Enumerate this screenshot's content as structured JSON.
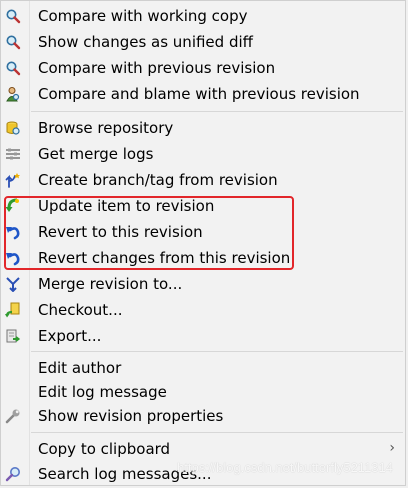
{
  "menu": {
    "items": [
      {
        "label": "Compare with working copy",
        "icon": "magnifier-icon"
      },
      {
        "label": "Show changes as unified diff",
        "icon": "magnifier-icon"
      },
      {
        "label": "Compare with previous revision",
        "icon": "magnifier-icon"
      },
      {
        "label": "Compare and blame with previous revision",
        "icon": "blame-icon"
      },
      {
        "label": "Browse repository",
        "icon": "repository-icon"
      },
      {
        "label": "Get merge logs",
        "icon": "merge-logs-icon"
      },
      {
        "label": "Create branch/tag from revision",
        "icon": "branch-icon"
      },
      {
        "label": "Update item to revision",
        "icon": "update-icon"
      },
      {
        "label": "Revert to this revision",
        "icon": "revert-icon"
      },
      {
        "label": "Revert changes from this revision",
        "icon": "revert-icon"
      },
      {
        "label": "Merge revision to...",
        "icon": "merge-icon"
      },
      {
        "label": "Checkout...",
        "icon": "checkout-icon"
      },
      {
        "label": "Export...",
        "icon": "export-icon"
      },
      {
        "label": "Edit author",
        "icon": ""
      },
      {
        "label": "Edit log message",
        "icon": ""
      },
      {
        "label": "Show revision properties",
        "icon": "wrench-icon"
      },
      {
        "label": "Copy to clipboard",
        "icon": "",
        "submenu_arrow": "›"
      },
      {
        "label": "Search log messages...",
        "icon": "search-icon"
      }
    ]
  },
  "watermark": "https://blog.csdn.net/butterfly5211314",
  "colors": {
    "highlight": "#e2262a",
    "menu_bg": "#f2f2f2"
  }
}
